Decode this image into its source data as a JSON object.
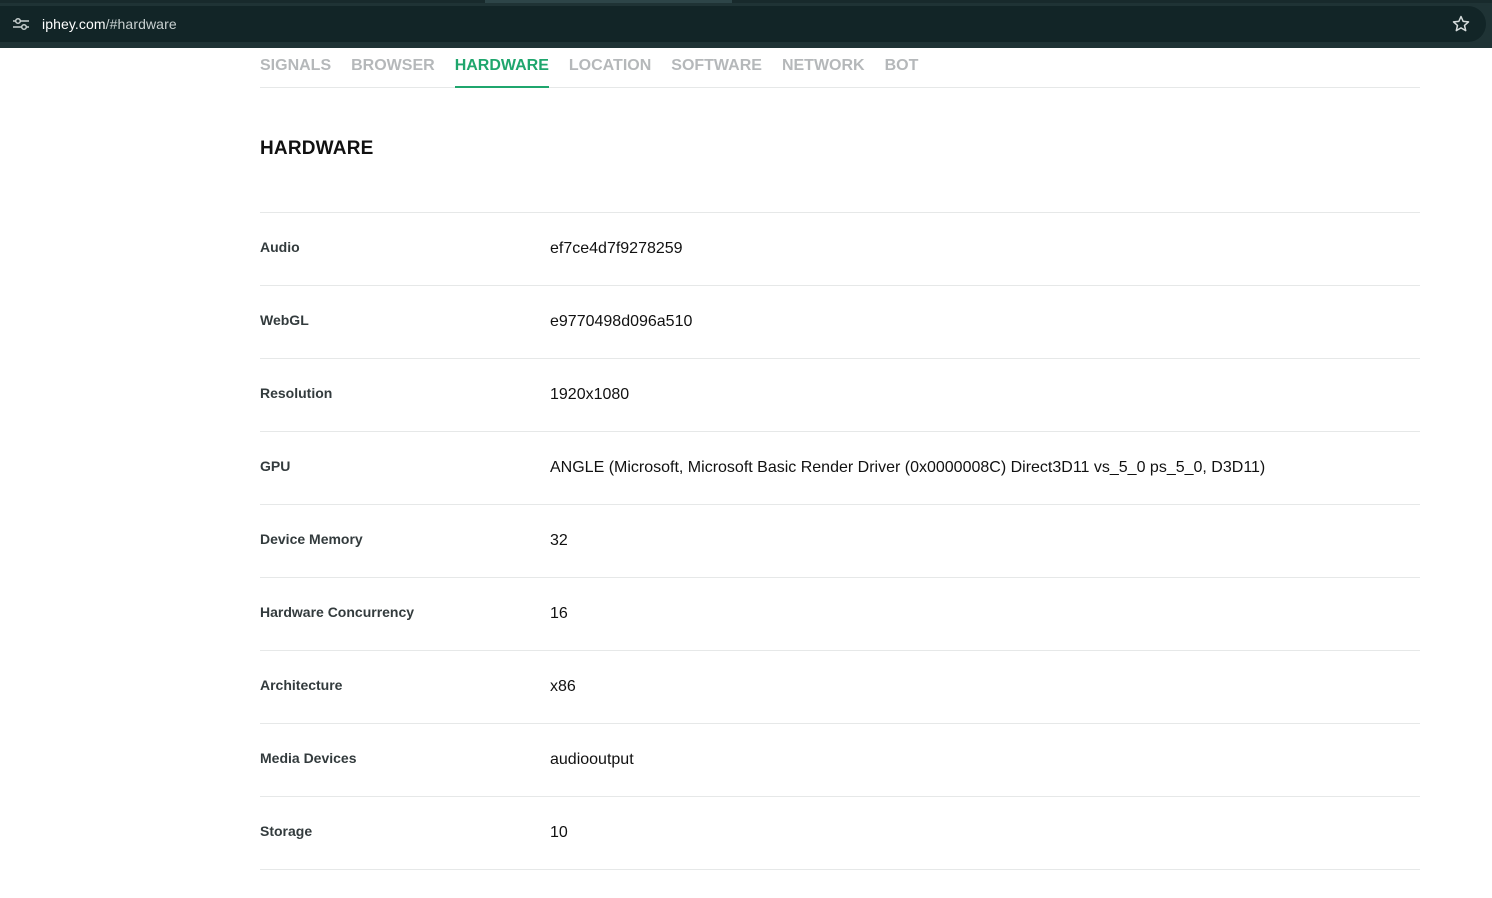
{
  "browser": {
    "url_domain": "iphey.com",
    "url_rest": "/#hardware"
  },
  "tabs": [
    {
      "label": "SIGNALS",
      "active": false
    },
    {
      "label": "BROWSER",
      "active": false
    },
    {
      "label": "HARDWARE",
      "active": true
    },
    {
      "label": "LOCATION",
      "active": false
    },
    {
      "label": "SOFTWARE",
      "active": false
    },
    {
      "label": "NETWORK",
      "active": false
    },
    {
      "label": "BOT",
      "active": false
    }
  ],
  "section": {
    "title": "HARDWARE"
  },
  "rows": [
    {
      "label": "Audio",
      "value": "ef7ce4d7f9278259"
    },
    {
      "label": "WebGL",
      "value": "e9770498d096a510"
    },
    {
      "label": "Resolution",
      "value": "1920x1080"
    },
    {
      "label": "GPU",
      "value": "ANGLE (Microsoft, Microsoft Basic Render Driver (0x0000008C) Direct3D11 vs_5_0 ps_5_0, D3D11)"
    },
    {
      "label": "Device Memory",
      "value": "32"
    },
    {
      "label": "Hardware Concurrency",
      "value": "16"
    },
    {
      "label": "Architecture",
      "value": "x86"
    },
    {
      "label": "Media Devices",
      "value": "audiooutput"
    },
    {
      "label": "Storage",
      "value": "10"
    }
  ],
  "colors": {
    "accent": "#1fa66d",
    "tab_inactive": "#b5b8ba",
    "chrome_bg": "#1f3335",
    "omnibox_bg": "#122527"
  },
  "icons": {
    "site_info": "tune-icon",
    "bookmark": "star-outline-icon"
  }
}
